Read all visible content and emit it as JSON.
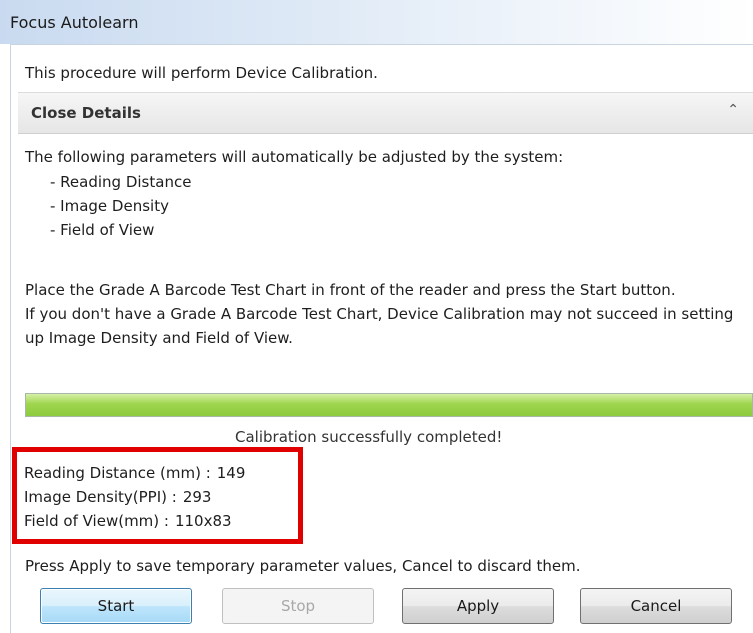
{
  "window": {
    "title": "Focus Autolearn"
  },
  "intro": "This procedure will perform Device Calibration.",
  "details": {
    "toggle_label": "Close Details"
  },
  "parameters": {
    "heading": "The following parameters will automatically be adjusted by the system:",
    "items": [
      "- Reading Distance",
      "- Image Density",
      "- Field of View"
    ]
  },
  "instructions": {
    "line1": "Place the Grade A Barcode Test Chart in front of the reader and press the Start button.",
    "line2": "If you don't have a Grade A Barcode Test Chart, Device Calibration may not succeed in setting up Image Density and Field of View."
  },
  "progress": {
    "percent": 100,
    "color": "#8dcb3e"
  },
  "status_message": "Calibration successfully completed!",
  "results": [
    {
      "label": "Reading Distance (mm) :",
      "value": "149"
    },
    {
      "label": "Image Density(PPI) :",
      "value": "293"
    },
    {
      "label": "Field of View(mm) :",
      "value": "110x83"
    }
  ],
  "highlight": {
    "color": "#e10000"
  },
  "footer_note": "Press Apply to save temporary parameter values, Cancel to discard them.",
  "buttons": {
    "start": "Start",
    "stop": "Stop",
    "apply": "Apply",
    "cancel": "Cancel"
  },
  "icons": {
    "collapse": "chevron-up-icon"
  }
}
